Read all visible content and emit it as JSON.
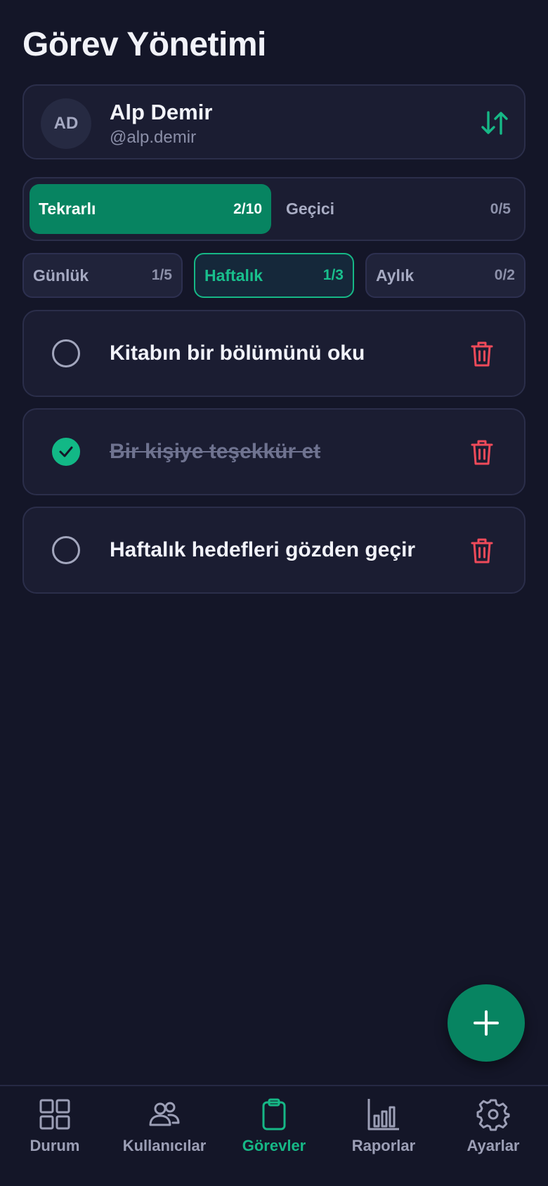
{
  "page": {
    "title": "Görev Yönetimi"
  },
  "user": {
    "initials": "AD",
    "name": "Alp Demir",
    "handle": "@alp.demir",
    "switch_icon": "swap-vertical-icon"
  },
  "type_tabs": [
    {
      "label": "Tekrarlı",
      "count": "2/10",
      "active": true
    },
    {
      "label": "Geçici",
      "count": "0/5",
      "active": false
    }
  ],
  "period_tabs": [
    {
      "label": "Günlük",
      "count": "1/5",
      "active": false
    },
    {
      "label": "Haftalık",
      "count": "1/3",
      "active": true
    },
    {
      "label": "Aylık",
      "count": "0/2",
      "active": false
    }
  ],
  "tasks": [
    {
      "text": "Kitabın bir bölümünü oku",
      "done": false
    },
    {
      "text": "Bir kişiye teşekkür et",
      "done": true
    },
    {
      "text": "Haftalık hedefleri gözden geçir",
      "done": false
    }
  ],
  "fab": {
    "icon": "plus-icon"
  },
  "nav": [
    {
      "label": "Durum",
      "icon": "grid-icon",
      "active": false
    },
    {
      "label": "Kullanıcılar",
      "icon": "users-icon",
      "active": false
    },
    {
      "label": "Görevler",
      "icon": "clipboard-icon",
      "active": true
    },
    {
      "label": "Raporlar",
      "icon": "bar-chart-icon",
      "active": false
    },
    {
      "label": "Ayarlar",
      "icon": "gear-icon",
      "active": false
    }
  ],
  "colors": {
    "background": "#141628",
    "card": "#1b1d32",
    "accent": "#078461",
    "accent_bright": "#16b886",
    "danger": "#ef4a5a"
  }
}
